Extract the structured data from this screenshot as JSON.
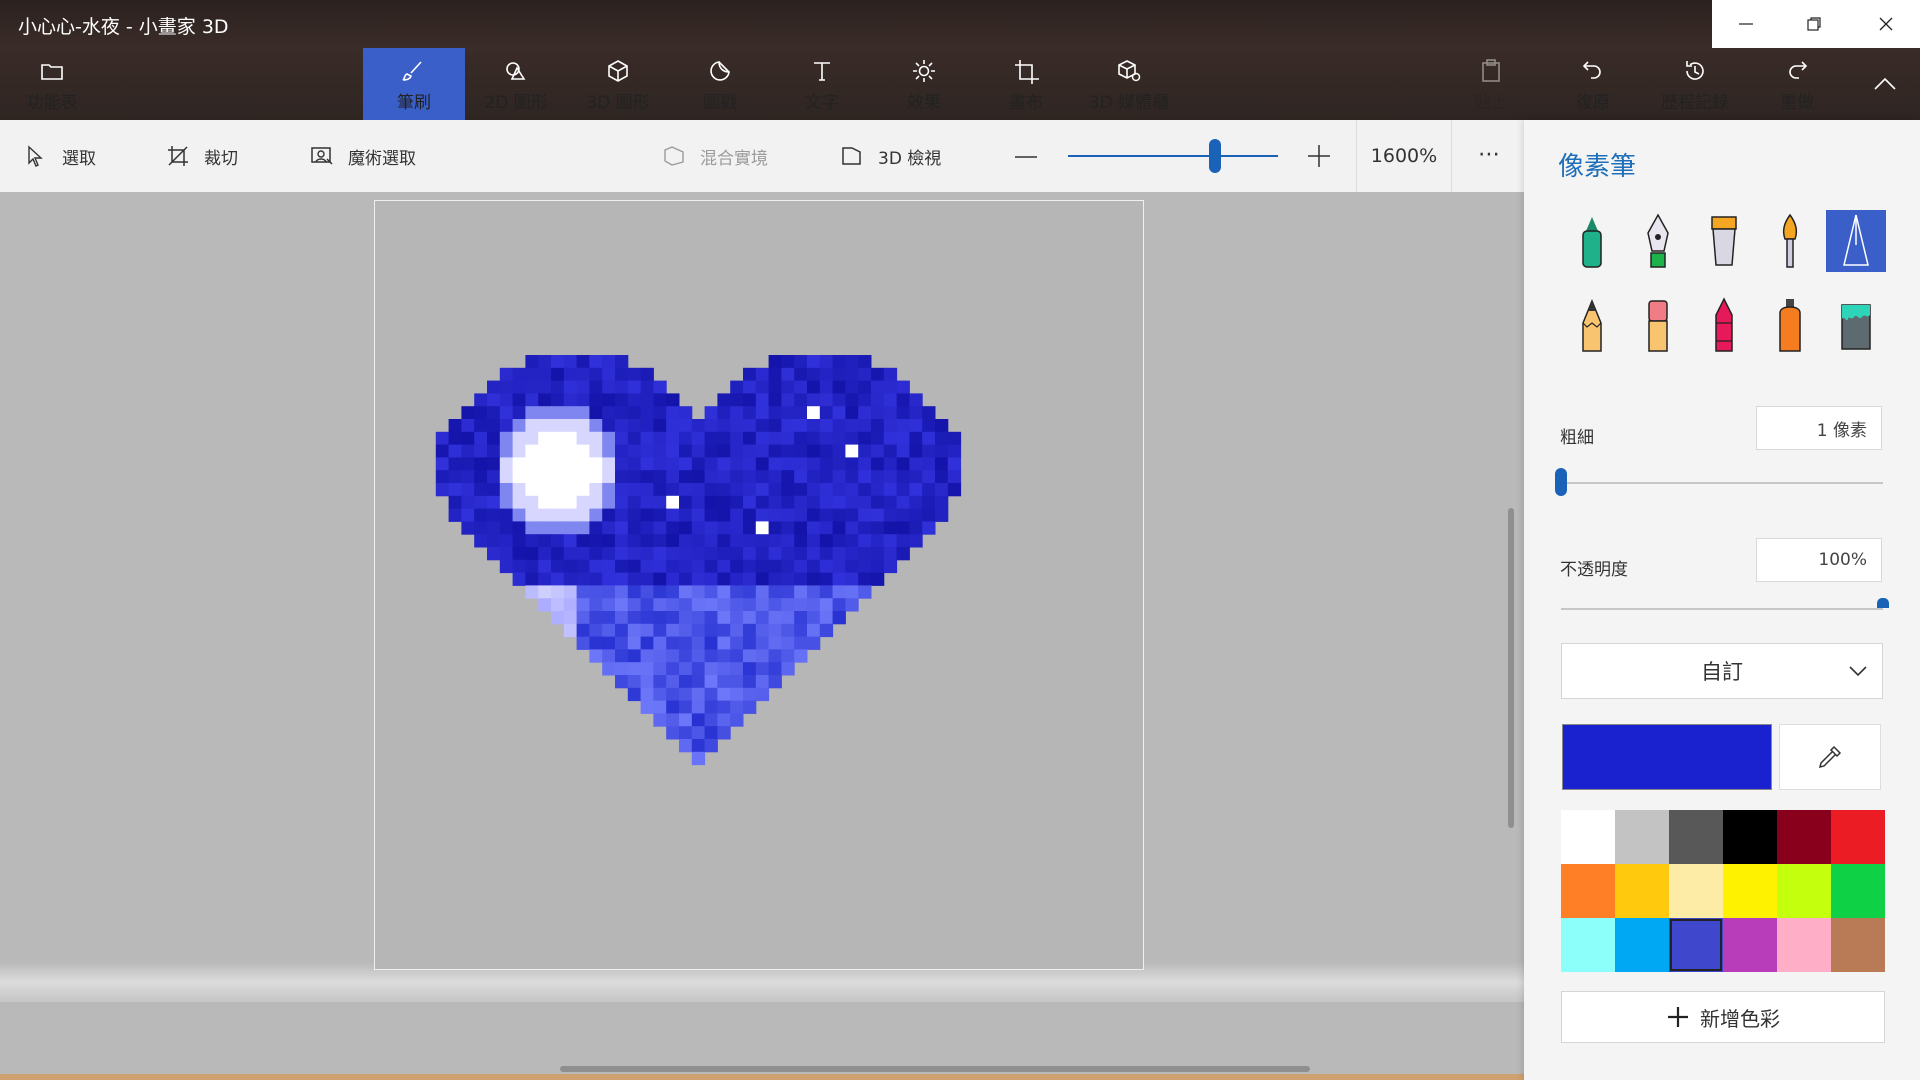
{
  "window": {
    "title": "小心心-水夜 - 小畫家 3D",
    "minimize_icon": "minimize-icon",
    "maximize_icon": "restore-icon",
    "close_icon": "close-icon"
  },
  "toolbar": {
    "menu_label": "功能表",
    "tabs": [
      {
        "label": "筆刷",
        "icon": "brush-icon",
        "active": true
      },
      {
        "label": "2D 圖形",
        "icon": "shapes-2d-icon"
      },
      {
        "label": "3D 圖形",
        "icon": "cube-icon"
      },
      {
        "label": "圖戳",
        "icon": "sticker-icon"
      },
      {
        "label": "文字",
        "icon": "text-icon"
      },
      {
        "label": "效果",
        "icon": "sun-icon"
      },
      {
        "label": "畫布",
        "icon": "canvas-icon"
      },
      {
        "label": "3D 媒體櫃",
        "icon": "library-icon"
      }
    ],
    "paste_label": "貼上",
    "undo_label": "復原",
    "history_label": "歷程記錄",
    "redo_label": "重做"
  },
  "subbar": {
    "select_label": "選取",
    "crop_label": "裁切",
    "magic_select_label": "魔術選取",
    "mixed_reality_label": "混合實境",
    "view3d_label": "3D 檢視",
    "zoom_value": "1600%",
    "zoom_level": 0.7,
    "more_label": "⋯"
  },
  "panel": {
    "title": "像素筆",
    "brushes": [
      "marker-icon",
      "calligraphy-pen-icon",
      "oil-brush-icon",
      "watercolor-icon",
      "pixel-pen-icon",
      "pencil-icon",
      "eraser-icon",
      "crayon-icon",
      "spray-can-icon",
      "fill-bucket-icon"
    ],
    "thickness_label": "粗細",
    "thickness_value": "1 像素",
    "thickness_level": 0.0,
    "opacity_label": "不透明度",
    "opacity_value": "100%",
    "opacity_level": 1.0,
    "dropdown_label": "自訂",
    "current_color": "#1a22d0",
    "palette": [
      "#ffffff",
      "#c3c3c3",
      "#585858",
      "#000000",
      "#88001b",
      "#ec1c24",
      "#ff7f27",
      "#ffc90e",
      "#fdeca6",
      "#fff200",
      "#c4ff0e",
      "#0ed145",
      "#8cfffb",
      "#00a8f3",
      "#3f48cc",
      "#b83dba",
      "#ffaec8",
      "#b97a56"
    ],
    "selected_palette_index": 14,
    "add_color_label": "新增色彩"
  }
}
